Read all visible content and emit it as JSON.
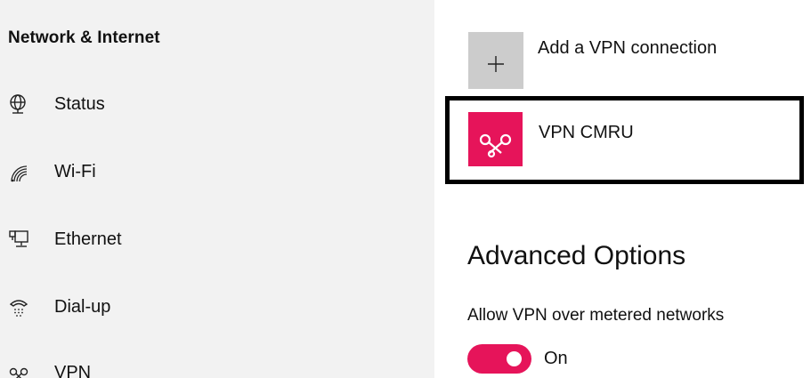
{
  "sidebar": {
    "title": "Network & Internet",
    "items": [
      {
        "label": "Status",
        "icon": "globe-icon"
      },
      {
        "label": "Wi-Fi",
        "icon": "wifi-icon"
      },
      {
        "label": "Ethernet",
        "icon": "ethernet-icon"
      },
      {
        "label": "Dial-up",
        "icon": "dialup-icon"
      },
      {
        "label": "VPN",
        "icon": "vpn-icon"
      }
    ]
  },
  "main": {
    "add_vpn_label": "Add a VPN connection",
    "vpn_connections": [
      {
        "name": "VPN CMRU",
        "icon": "vpn-icon"
      }
    ],
    "advanced_title": "Advanced Options",
    "metered": {
      "label": "Allow VPN over metered networks",
      "state": "On",
      "enabled": true
    }
  },
  "colors": {
    "accent": "#e6145a",
    "sidebar_bg": "#f2f2f2",
    "add_tile_bg": "#cccccc"
  }
}
